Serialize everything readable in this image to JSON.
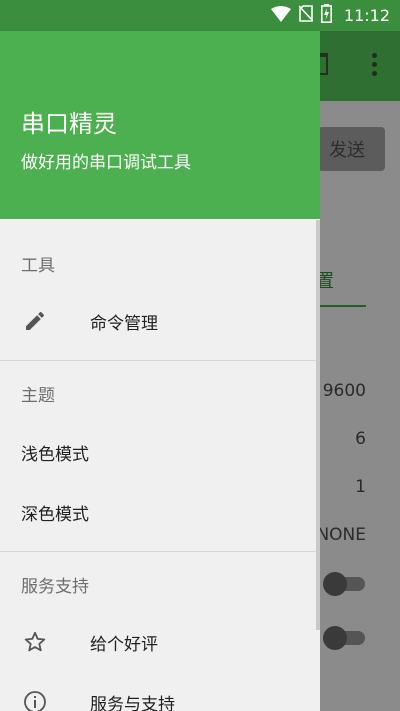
{
  "status_bar": {
    "time": "11:12",
    "icons": [
      "wifi-icon",
      "no-sim-icon",
      "battery-charging-icon"
    ]
  },
  "background_app": {
    "send_button_label": "发送",
    "settings_tab_label": "置",
    "settings_values": [
      "9600",
      "6",
      "1",
      "NONE"
    ],
    "toggles": [
      "off",
      "off"
    ]
  },
  "drawer": {
    "header": {
      "title": "串口精灵",
      "subtitle": "做好用的串口调试工具",
      "color": "#4caf50"
    },
    "sections": [
      {
        "label": "工具",
        "items": [
          {
            "label": "命令管理",
            "icon": "pencil-icon"
          }
        ]
      },
      {
        "label": "主题",
        "items": [
          {
            "label": "浅色模式"
          },
          {
            "label": "深色模式"
          }
        ]
      },
      {
        "label": "服务支持",
        "items": [
          {
            "label": "给个好评",
            "icon": "star-icon"
          },
          {
            "label": "服务与支持",
            "icon": "info-icon"
          }
        ]
      }
    ]
  }
}
